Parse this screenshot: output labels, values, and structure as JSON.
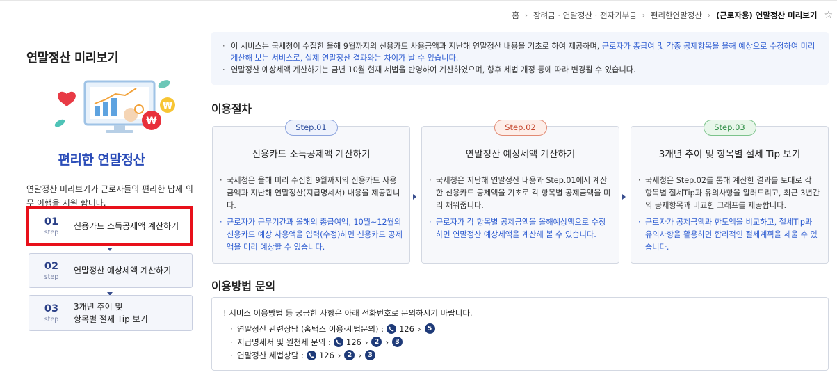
{
  "breadcrumb": {
    "items": [
      "홈",
      "장려금 · 연말정산 · 전자기부금",
      "편리한연말정산",
      "(근로자용) 연말정산 미리보기"
    ]
  },
  "sidebar": {
    "title": "연말정산 미리보기",
    "brand": "편리한 연말정산",
    "description": "연말정산 미리보기가 근로자들의  편리한 납세 의무 이행을 지원 합니다.",
    "steps": [
      {
        "num": "01",
        "step": "step",
        "label": "신용카드 소득공제액 계산하기"
      },
      {
        "num": "02",
        "step": "step",
        "label": "연말정산 예상세액 계산하기"
      },
      {
        "num": "03",
        "step": "step",
        "label_line1": "3개년 추이 및",
        "label_line2": "항목별 절세 Tip 보기"
      }
    ]
  },
  "notice": {
    "line1_a": "이 서비스는 국세청이 수집한 올해 9월까지의 신용카드 사용금액과 지난해 연말정산 내용을 기초로 하여 제공하며, ",
    "line1_b": "근로자가 총급여 및 각종 공제항목을 올해 예상으로 수정하여 미리 계산해 보는 서비스로, 실제 연말정산 결과와는 차이가 날 수 있습니다.",
    "line2": "연말정산 예상세액 계산하기는 금년 10월 현재 세법을 반영하여 계산하였으며, 향후 세법 개정 등에 따라 변경될 수 있습니다."
  },
  "procedure": {
    "title": "이용절차",
    "cards": [
      {
        "pill": "Step.01",
        "title": "신용카드 소득공제액 계산하기",
        "item": "국세청은 올해 미리 수집한 9월까지의 신용카드 사용금액과 지난해 연말정산(지급명세서) 내용을 제공합니다.",
        "blue": "근로자가 근무기간과 올해의 총급여액, 10월~12월의 신용카드 예상 사용액을 입력(수정)하면 신용카드 공제액을 미리 예상할 수 있습니다."
      },
      {
        "pill": "Step.02",
        "title": "연말정산 예상세액 계산하기",
        "item": "국세청은 지난해 연말정산 내용과 Step.01에서 계산한 신용카드 공제액을 기초로 각 항목별 공제금액을 미리 채워줍니다.",
        "blue": "근로자가 각 항목별 공제금액을 올해예상액으로 수정하면 연말정산 예상세액을 계산해 볼 수 있습니다."
      },
      {
        "pill": "Step.03",
        "title": "3개년 추이 및 항목별 절세 Tip 보기",
        "item": "국세청은 Step.02를 통해 계산한 결과를 토대로 각 항목별 절세Tip과 유의사항을 알려드리고, 최근 3년간의 공제항목과 비교한 그래프를 제공합니다.",
        "blue": "근로자가 공제금액과 한도액을 비교하고, 절세Tip과 유의사항을 활용하면 합리적인 절세계획을 세울 수 있습니다."
      }
    ]
  },
  "inquiry": {
    "title": "이용방법 문의",
    "head": "! 서비스 이용방법 등 궁금한 사항은 아래 전화번호로 문의하시기 바랍니다.",
    "lines": [
      {
        "label": "연말정산 관련상담 (홈택스 이용·세법문의) :",
        "number": "126",
        "opts": [
          "5"
        ]
      },
      {
        "label": "지급명세서 및 원천세 문의 :",
        "number": "126",
        "opts": [
          "2",
          "3"
        ]
      },
      {
        "label": "연말정산 세법상담 :",
        "number": "126",
        "opts": [
          "2",
          "3"
        ]
      }
    ]
  },
  "colors": {
    "accent": "#2a4cb8",
    "highlight_border": "#e8101a",
    "link_blue": "#2c5bd0"
  }
}
